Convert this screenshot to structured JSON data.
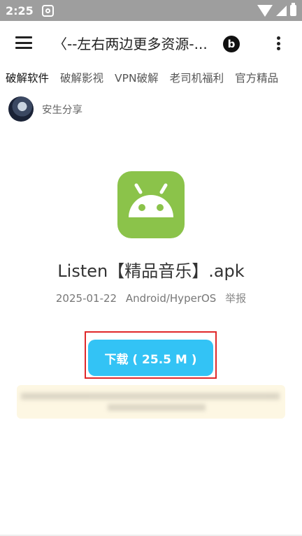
{
  "status_bar": {
    "time": "2:25"
  },
  "app_bar": {
    "title": "〈--左右两边更多资源-...",
    "b_icon_label": "b"
  },
  "tabs": [
    "破解软件",
    "破解影视",
    "VPN破解",
    "老司机福利",
    "官方精品"
  ],
  "author": {
    "name": "安生分享"
  },
  "file": {
    "title": "Listen【精品音乐】.apk",
    "date": "2025-01-22",
    "platform": "Android/HyperOS",
    "report": "举报"
  },
  "download": {
    "label": "下载 ( 25.5 M )"
  },
  "colors": {
    "accent": "#33c3f5",
    "app_icon": "#8bc34a",
    "highlight": "#e0282a",
    "notice_bg": "#fdf7e3"
  }
}
